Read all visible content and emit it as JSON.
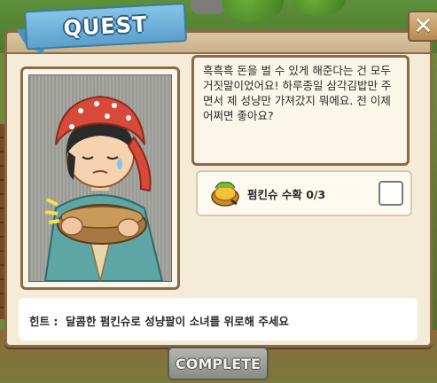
{
  "quest": {
    "banner_title": "QUEST",
    "close_icon": "close-x-icon",
    "speech": "흑흑흑 돈을 벌 수 있게 해준다는 건 모두 거짓말이었어요! 하루종일 삼각김밥만 주면서 제 성냥만 가져갔지 뭐에요. 전 이제 어쩌면 좋아요?",
    "task": {
      "icon": "pumpkin-pie-icon",
      "label": "펌킨슈 수확 0/3",
      "completed": false
    },
    "hint": "힌트 :  달콤한 펌킨슈로 성냥팔이 소녀를 위로해 주세요",
    "complete_button": "COMPLETE",
    "complete_enabled": false
  },
  "colors": {
    "banner": "#6aaed8",
    "panel": "#f4ecd9",
    "border": "#8a6a44",
    "button_disabled": "#9a9a96"
  }
}
